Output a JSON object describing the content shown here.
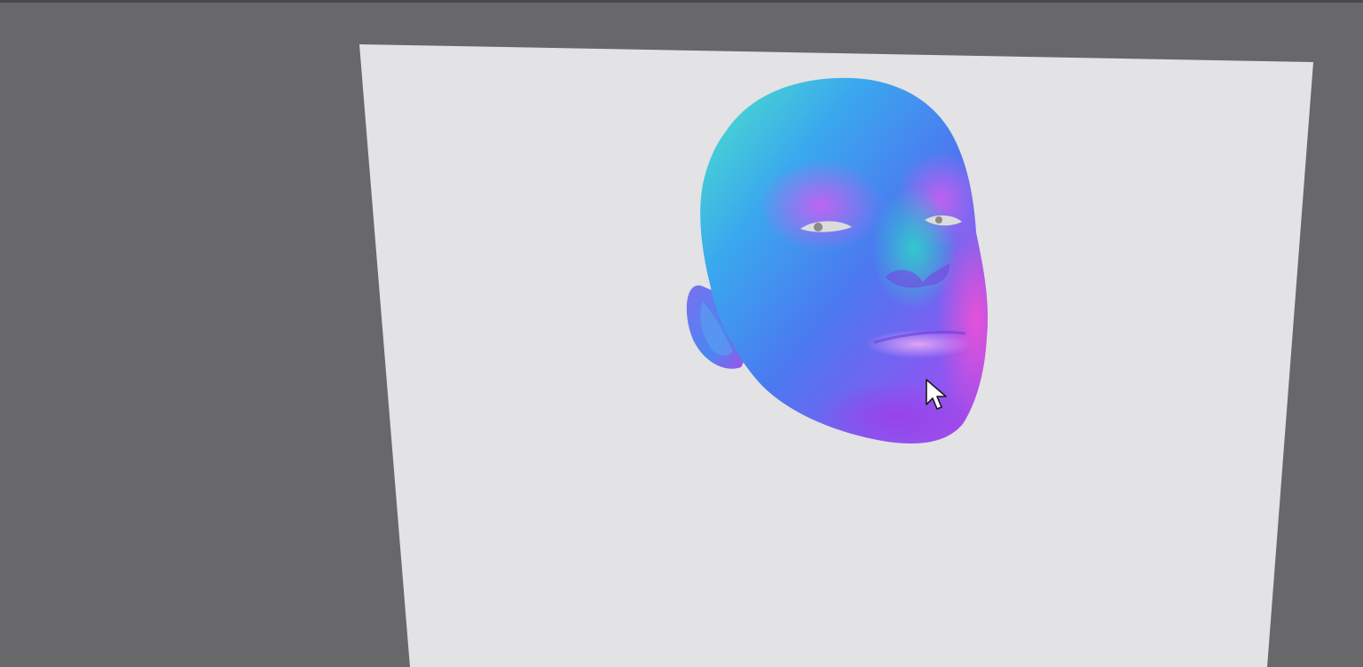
{
  "viewport": {
    "background_color": "#68686a",
    "backdrop_color": "#e3e2e4"
  },
  "scene": {
    "object": "head mesh",
    "shading": "normal-map",
    "palette": [
      "#4de6c8",
      "#3a9ff0",
      "#5a6cf2",
      "#9a5cf4",
      "#f04fd6"
    ]
  },
  "cursor": {
    "icon": "arrow-cursor-icon"
  }
}
